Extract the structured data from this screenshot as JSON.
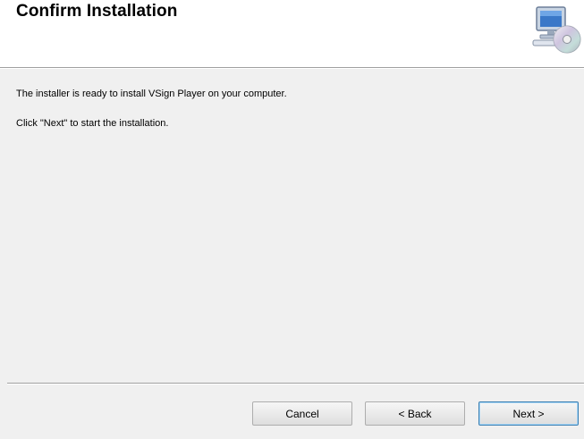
{
  "header": {
    "title": "Confirm Installation",
    "icon": "computer-cd-icon"
  },
  "content": {
    "line1": "The installer is ready to install VSign Player on your computer.",
    "line2": "Click \"Next\" to start the installation."
  },
  "buttons": {
    "cancel": "Cancel",
    "back": "< Back",
    "next": "Next >"
  },
  "colors": {
    "header_bg": "#ffffff",
    "body_bg": "#f0f0f0",
    "default_button_border": "#3c7fb1"
  }
}
